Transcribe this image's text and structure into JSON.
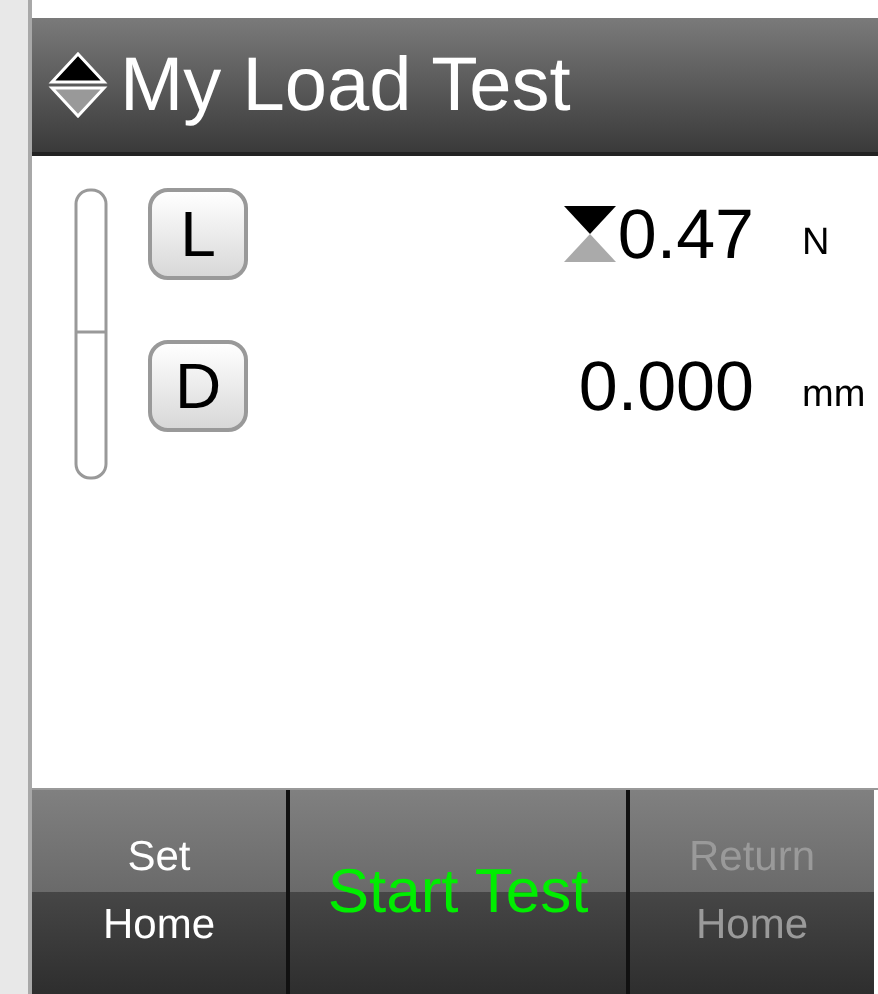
{
  "header": {
    "title": "My Load Test"
  },
  "channels": [
    {
      "key": "L",
      "reading": "0.47",
      "unit": "N",
      "tare": true
    },
    {
      "key": "D",
      "reading": "0.000",
      "unit": "mm",
      "tare": false
    }
  ],
  "buttons": [
    {
      "label": "Set Home",
      "kind": "normal",
      "disabled": false
    },
    {
      "label": "Start Test",
      "kind": "start",
      "disabled": false
    },
    {
      "label": "Return Home",
      "kind": "normal",
      "disabled": true
    }
  ]
}
